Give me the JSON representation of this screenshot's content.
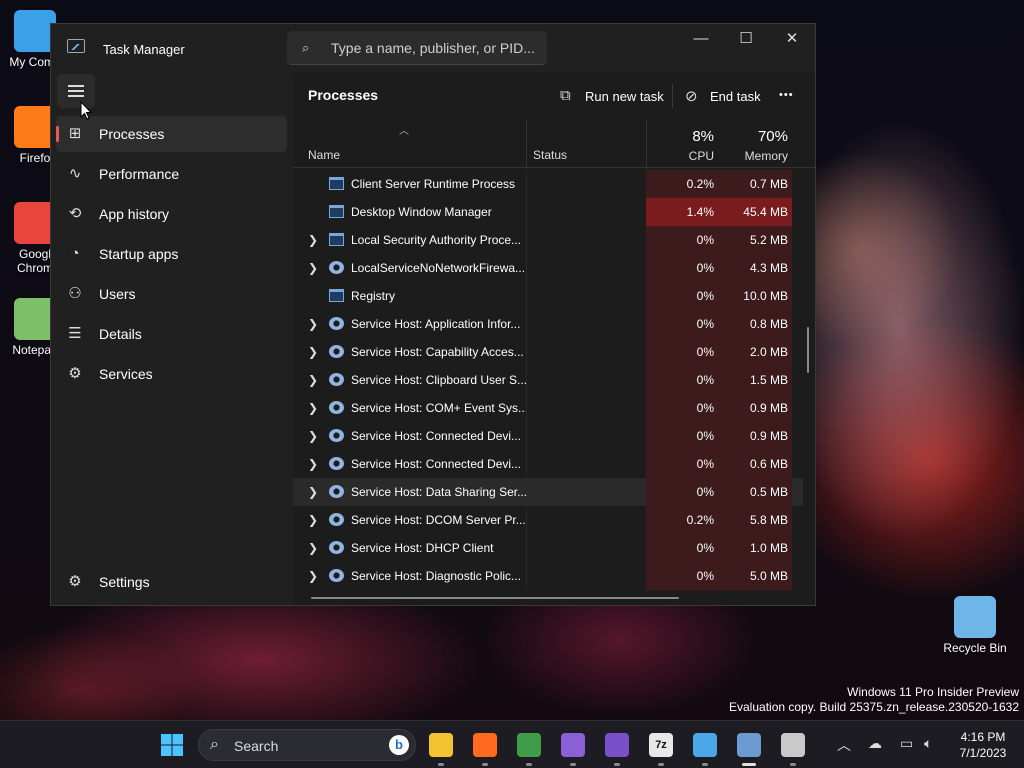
{
  "desktop": {
    "icons": [
      {
        "label": "My Comp",
        "color": "#3aa0e8"
      },
      {
        "label": "Firefo",
        "color": "#ff7a18"
      },
      {
        "label": "Googl Chrom",
        "color": "#e8453c"
      },
      {
        "label": "Notepad",
        "color": "#7ec06a"
      },
      {
        "label": "Recycle Bin",
        "color": "#6fb6e8"
      }
    ],
    "watermark_line1": "Windows 11 Pro Insider Preview",
    "watermark_line2": "Evaluation copy. Build 25375.zn_release.230520-1632"
  },
  "window": {
    "title": "Task Manager",
    "search_placeholder": "Type a name, publisher, or PID...",
    "controls": {
      "minimize": "—",
      "maximize": "☐",
      "close": "✕"
    }
  },
  "sidebar": {
    "items": [
      {
        "label": "Processes",
        "icon": "⊞",
        "active": true
      },
      {
        "label": "Performance",
        "icon": "∿"
      },
      {
        "label": "App history",
        "icon": "⟲"
      },
      {
        "label": "Startup apps",
        "icon": "◔"
      },
      {
        "label": "Users",
        "icon": "⚇"
      },
      {
        "label": "Details",
        "icon": "☰"
      },
      {
        "label": "Services",
        "icon": "⚙"
      }
    ],
    "settings_label": "Settings",
    "settings_icon": "⚙"
  },
  "toolbar": {
    "title": "Processes",
    "run_new_task": "Run new task",
    "end_task": "End task",
    "more": "•••"
  },
  "columns": {
    "name": "Name",
    "status": "Status",
    "cpu_pct": "8%",
    "cpu": "CPU",
    "mem_pct": "70%",
    "memory": "Memory"
  },
  "processes": [
    {
      "name": "Client Server Runtime Process",
      "cpu": "0.2%",
      "mem": "0.7 MB",
      "expandable": false,
      "icon": "win"
    },
    {
      "name": "Desktop Window Manager",
      "cpu": "1.4%",
      "mem": "45.4 MB",
      "expandable": false,
      "icon": "win",
      "hot": true
    },
    {
      "name": "Local Security Authority Proce...",
      "cpu": "0%",
      "mem": "5.2 MB",
      "expandable": true,
      "icon": "win"
    },
    {
      "name": "LocalServiceNoNetworkFirewa...",
      "cpu": "0%",
      "mem": "4.3 MB",
      "expandable": true,
      "icon": "gear"
    },
    {
      "name": "Registry",
      "cpu": "0%",
      "mem": "10.0 MB",
      "expandable": false,
      "icon": "win"
    },
    {
      "name": "Service Host: Application Infor...",
      "cpu": "0%",
      "mem": "0.8 MB",
      "expandable": true,
      "icon": "gear"
    },
    {
      "name": "Service Host: Capability Acces...",
      "cpu": "0%",
      "mem": "2.0 MB",
      "expandable": true,
      "icon": "gear"
    },
    {
      "name": "Service Host: Clipboard User S...",
      "cpu": "0%",
      "mem": "1.5 MB",
      "expandable": true,
      "icon": "gear"
    },
    {
      "name": "Service Host: COM+ Event Sys...",
      "cpu": "0%",
      "mem": "0.9 MB",
      "expandable": true,
      "icon": "gear"
    },
    {
      "name": "Service Host: Connected Devi...",
      "cpu": "0%",
      "mem": "0.9 MB",
      "expandable": true,
      "icon": "gear"
    },
    {
      "name": "Service Host: Connected Devi...",
      "cpu": "0%",
      "mem": "0.6 MB",
      "expandable": true,
      "icon": "gear"
    },
    {
      "name": "Service Host: Data Sharing Ser...",
      "cpu": "0%",
      "mem": "0.5 MB",
      "expandable": true,
      "icon": "gear",
      "hover": true
    },
    {
      "name": "Service Host: DCOM Server Pr...",
      "cpu": "0.2%",
      "mem": "5.8 MB",
      "expandable": true,
      "icon": "gear"
    },
    {
      "name": "Service Host: DHCP Client",
      "cpu": "0%",
      "mem": "1.0 MB",
      "expandable": true,
      "icon": "gear"
    },
    {
      "name": "Service Host: Diagnostic Polic...",
      "cpu": "0%",
      "mem": "5.0 MB",
      "expandable": true,
      "icon": "gear"
    }
  ],
  "taskbar": {
    "search_label": "Search",
    "bing_letter": "b",
    "apps": [
      {
        "name": "file-explorer",
        "color": "#f2c230"
      },
      {
        "name": "firefox",
        "color": "#ff6a20"
      },
      {
        "name": "chrome",
        "color": "#3f9d4a"
      },
      {
        "name": "visual-studio",
        "color": "#8c5fd6"
      },
      {
        "name": "visual-studio-2",
        "color": "#7b4fc9"
      },
      {
        "name": "7zip",
        "color": "#e8e8e8",
        "label": "7z"
      },
      {
        "name": "notepad",
        "color": "#4aa8e8"
      },
      {
        "name": "task-manager",
        "color": "#6b9bd1"
      },
      {
        "name": "app",
        "color": "#c9c9c9"
      }
    ],
    "time": "4:16 PM",
    "date": "7/1/2023"
  }
}
